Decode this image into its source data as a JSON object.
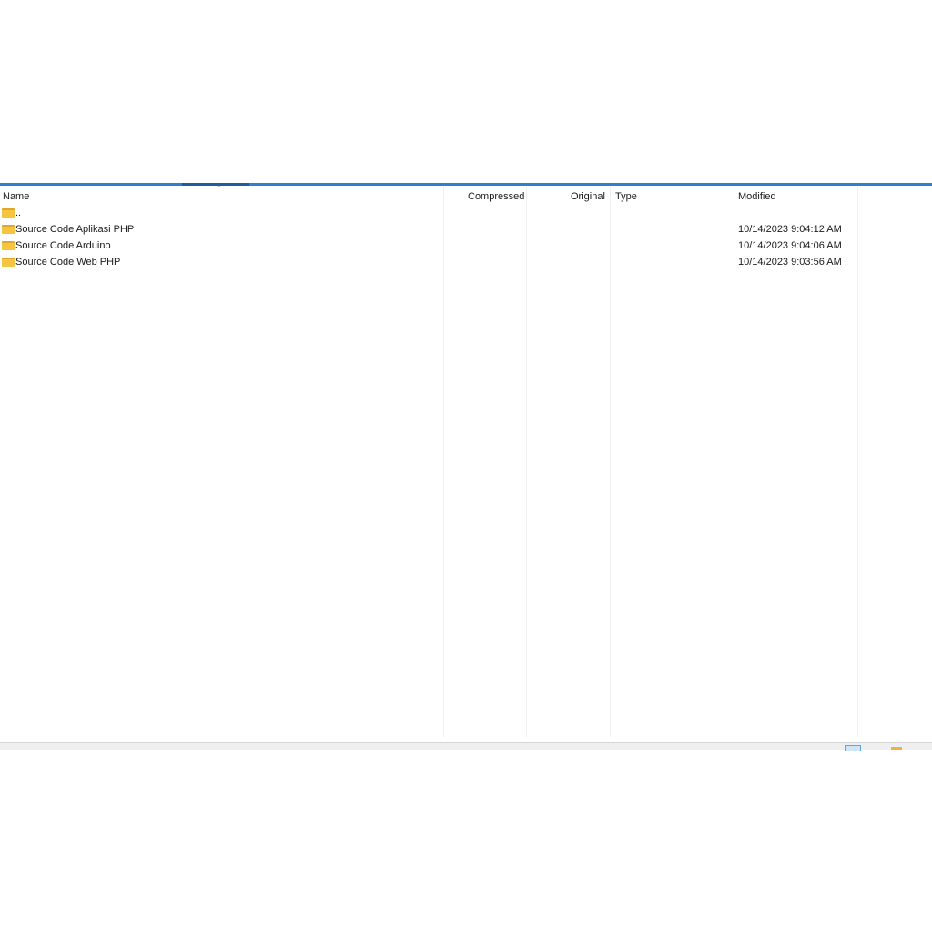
{
  "columns": {
    "name": "Name",
    "compressed": "Compressed",
    "original": "Original",
    "type": "Type",
    "modified": "Modified"
  },
  "sort_indicator": "^",
  "rows": [
    {
      "name": "..",
      "modified": ""
    },
    {
      "name": "Source Code Aplikasi PHP",
      "modified": "10/14/2023 9:04:12 AM"
    },
    {
      "name": "Source Code Arduino",
      "modified": "10/14/2023 9:04:06 AM"
    },
    {
      "name": "Source Code Web PHP",
      "modified": "10/14/2023 9:03:56 AM"
    }
  ]
}
